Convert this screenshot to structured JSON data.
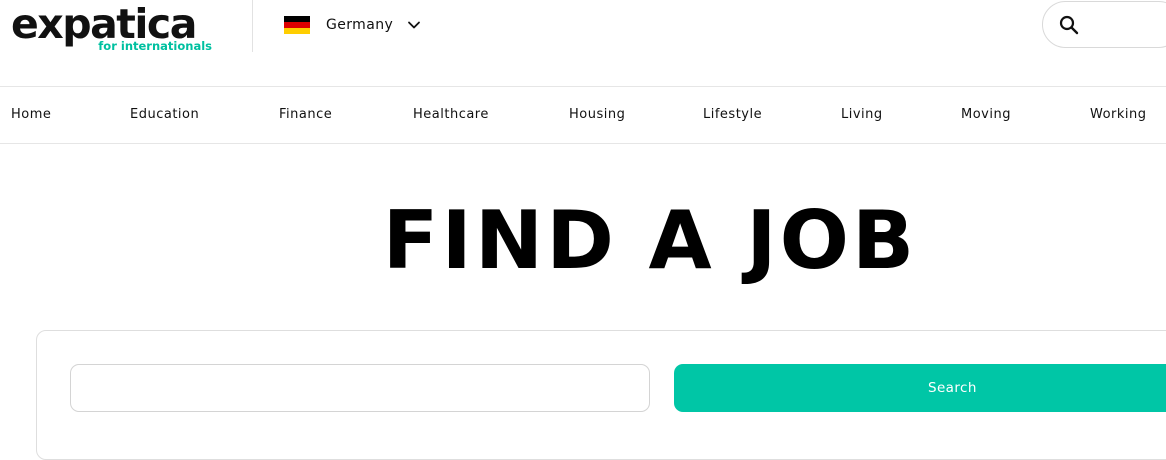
{
  "brand": {
    "name": "expatica",
    "tagline": "for internationals",
    "accent_color": "#00c6a6"
  },
  "header": {
    "country": {
      "label": "Germany",
      "flag_icon": "germany-flag-icon",
      "flag_colors": [
        "#000000",
        "#dd0000",
        "#ffce00"
      ],
      "chevron_icon": "chevron-down-icon"
    },
    "search_icon": "search-icon"
  },
  "nav": {
    "items": [
      {
        "label": "Home"
      },
      {
        "label": "Education"
      },
      {
        "label": "Finance"
      },
      {
        "label": "Healthcare"
      },
      {
        "label": "Housing"
      },
      {
        "label": "Lifestyle"
      },
      {
        "label": "Living"
      },
      {
        "label": "Moving"
      },
      {
        "label": "Working"
      }
    ]
  },
  "hero": {
    "title": "FIND A JOB"
  },
  "job_search": {
    "input_value": "",
    "button_label": "Search"
  }
}
